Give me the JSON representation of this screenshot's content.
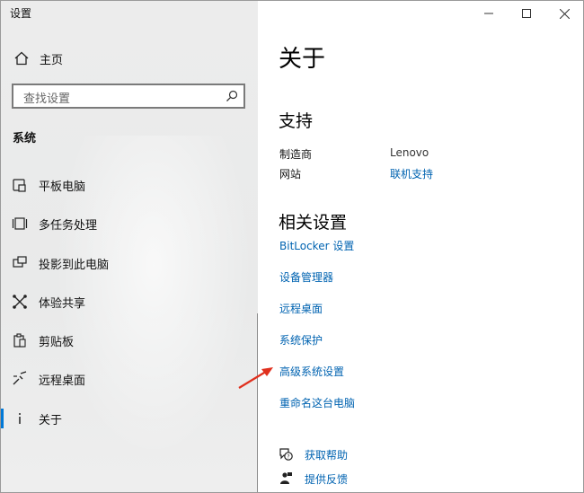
{
  "window": {
    "title": "设置"
  },
  "sidebar": {
    "home_label": "主页",
    "search_placeholder": "查找设置",
    "section_label": "系统",
    "items": [
      {
        "label": "平板电脑",
        "icon": "tablet-icon"
      },
      {
        "label": "多任务处理",
        "icon": "multitasking-icon"
      },
      {
        "label": "投影到此电脑",
        "icon": "project-icon"
      },
      {
        "label": "体验共享",
        "icon": "share-icon"
      },
      {
        "label": "剪贴板",
        "icon": "clipboard-icon"
      },
      {
        "label": "远程桌面",
        "icon": "remote-desktop-icon"
      },
      {
        "label": "关于",
        "icon": "info-icon",
        "selected": true
      }
    ]
  },
  "main": {
    "page_title": "关于",
    "support": {
      "heading": "支持",
      "manufacturer_label": "制造商",
      "manufacturer_value": "Lenovo",
      "website_label": "网站",
      "website_value": "联机支持"
    },
    "related": {
      "heading": "相关设置",
      "links": [
        "BitLocker 设置",
        "设备管理器",
        "远程桌面",
        "系统保护",
        "高级系统设置",
        "重命名这台电脑"
      ]
    },
    "help": [
      {
        "label": "获取帮助",
        "icon": "help-icon"
      },
      {
        "label": "提供反馈",
        "icon": "feedback-icon"
      }
    ]
  },
  "colors": {
    "accent": "#0078d7",
    "link": "#0063b1",
    "arrow": "#e0301e"
  }
}
